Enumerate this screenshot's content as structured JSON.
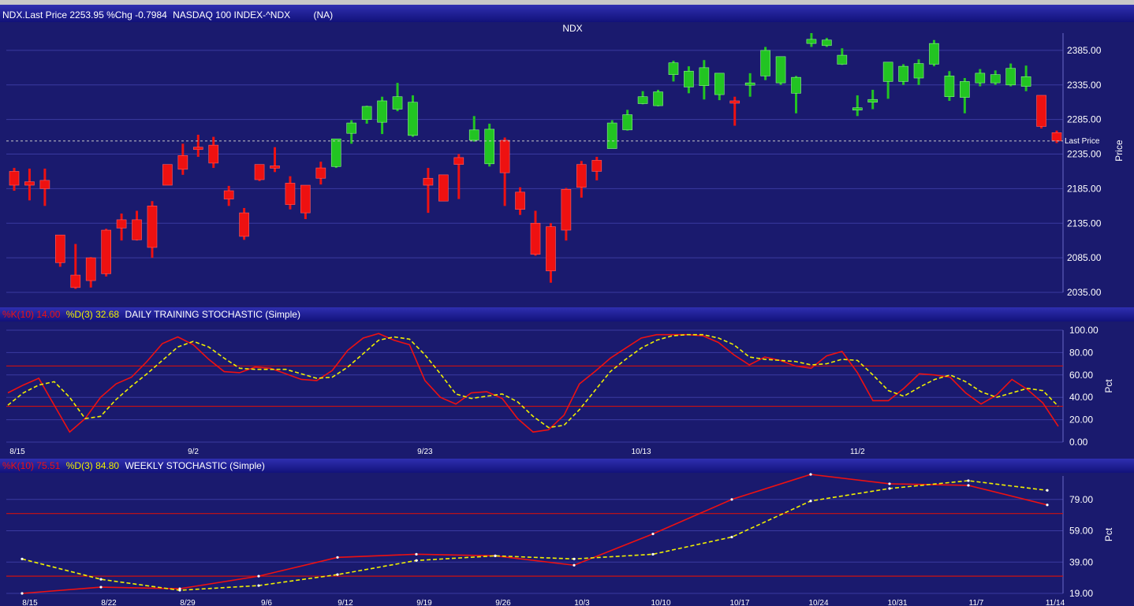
{
  "header_main": {
    "symbol_line": "NDX.Last Price 2253.95 %Chg -0.7984",
    "name": "NASDAQ 100 INDEX-^NDX",
    "status": "(NA)"
  },
  "header_daily": {
    "k_label": "%K(10) 14.00",
    "d_label": "%D(3) 32.68",
    "title": "DAILY TRAINING STOCHASTIC (Simple)"
  },
  "header_weekly": {
    "k_label": "%K(10) 75.51",
    "d_label": "%D(3) 84.80",
    "title": "WEEKLY STOCHASTIC (Simple)"
  },
  "colors": {
    "up": "#22c422",
    "down": "#ee1111",
    "k_line": "#ee1111",
    "d_line": "#f0f000",
    "threshold": "#cc1111",
    "last_price": "#c8c8c8",
    "title_green": "#22cc22"
  },
  "chart_data": [
    {
      "type": "candlestick",
      "title": "NDX",
      "ylabel": "Price",
      "ylim": [
        2035,
        2410
      ],
      "yticks": [
        2035,
        2085,
        2135,
        2185,
        2235,
        2285,
        2335,
        2385
      ],
      "ytick_labels": [
        "2035.00",
        "2085.00",
        "2135.00",
        "2185.00",
        "2235.00",
        "2285.00",
        "2335.00",
        "2385.00"
      ],
      "last_price": 2253.95,
      "last_price_label": "Last Price",
      "candles": [
        {
          "o": 2210,
          "h": 2215,
          "l": 2182,
          "c": 2190
        },
        {
          "o": 2195,
          "h": 2214,
          "l": 2168,
          "c": 2190
        },
        {
          "o": 2197,
          "h": 2214,
          "l": 2160,
          "c": 2185
        },
        {
          "o": 2118,
          "h": 2118,
          "l": 2072,
          "c": 2078
        },
        {
          "o": 2060,
          "h": 2105,
          "l": 2040,
          "c": 2042
        },
        {
          "o": 2085,
          "h": 2086,
          "l": 2042,
          "c": 2052
        },
        {
          "o": 2125,
          "h": 2127,
          "l": 2058,
          "c": 2062
        },
        {
          "o": 2140,
          "h": 2149,
          "l": 2110,
          "c": 2128
        },
        {
          "o": 2140,
          "h": 2153,
          "l": 2110,
          "c": 2111
        },
        {
          "o": 2160,
          "h": 2167,
          "l": 2085,
          "c": 2100
        },
        {
          "o": 2220,
          "h": 2220,
          "l": 2190,
          "c": 2190
        },
        {
          "o": 2233,
          "h": 2250,
          "l": 2205,
          "c": 2213
        },
        {
          "o": 2245,
          "h": 2263,
          "l": 2231,
          "c": 2242
        },
        {
          "o": 2248,
          "h": 2260,
          "l": 2215,
          "c": 2222
        },
        {
          "o": 2182,
          "h": 2189,
          "l": 2160,
          "c": 2170
        },
        {
          "o": 2150,
          "h": 2157,
          "l": 2111,
          "c": 2116
        },
        {
          "o": 2220,
          "h": 2220,
          "l": 2196,
          "c": 2198
        },
        {
          "o": 2218,
          "h": 2245,
          "l": 2209,
          "c": 2217
        },
        {
          "o": 2193,
          "h": 2203,
          "l": 2155,
          "c": 2162
        },
        {
          "o": 2190,
          "h": 2190,
          "l": 2141,
          "c": 2150
        },
        {
          "o": 2215,
          "h": 2224,
          "l": 2191,
          "c": 2200
        },
        {
          "o": 2217,
          "h": 2257,
          "l": 2215,
          "c": 2257
        },
        {
          "o": 2265,
          "h": 2284,
          "l": 2250,
          "c": 2280
        },
        {
          "o": 2285,
          "h": 2305,
          "l": 2279,
          "c": 2304
        },
        {
          "o": 2281,
          "h": 2318,
          "l": 2264,
          "c": 2312
        },
        {
          "o": 2300,
          "h": 2338,
          "l": 2297,
          "c": 2318
        },
        {
          "o": 2262,
          "h": 2320,
          "l": 2260,
          "c": 2310
        },
        {
          "o": 2200,
          "h": 2215,
          "l": 2150,
          "c": 2190
        },
        {
          "o": 2205,
          "h": 2205,
          "l": 2167,
          "c": 2167
        },
        {
          "o": 2230,
          "h": 2235,
          "l": 2170,
          "c": 2220
        },
        {
          "o": 2255,
          "h": 2290,
          "l": 2253,
          "c": 2270
        },
        {
          "o": 2221,
          "h": 2279,
          "l": 2217,
          "c": 2271
        },
        {
          "o": 2255,
          "h": 2259,
          "l": 2160,
          "c": 2208
        },
        {
          "o": 2180,
          "h": 2187,
          "l": 2147,
          "c": 2155
        },
        {
          "o": 2135,
          "h": 2153,
          "l": 2088,
          "c": 2090
        },
        {
          "o": 2130,
          "h": 2135,
          "l": 2049,
          "c": 2066
        },
        {
          "o": 2184,
          "h": 2186,
          "l": 2110,
          "c": 2125
        },
        {
          "o": 2220,
          "h": 2225,
          "l": 2172,
          "c": 2187
        },
        {
          "o": 2226,
          "h": 2231,
          "l": 2197,
          "c": 2210
        },
        {
          "o": 2243,
          "h": 2284,
          "l": 2243,
          "c": 2280
        },
        {
          "o": 2270,
          "h": 2299,
          "l": 2269,
          "c": 2292
        },
        {
          "o": 2308,
          "h": 2326,
          "l": 2307,
          "c": 2318
        },
        {
          "o": 2305,
          "h": 2328,
          "l": 2304,
          "c": 2325
        },
        {
          "o": 2350,
          "h": 2370,
          "l": 2340,
          "c": 2367
        },
        {
          "o": 2332,
          "h": 2362,
          "l": 2323,
          "c": 2355
        },
        {
          "o": 2334,
          "h": 2371,
          "l": 2314,
          "c": 2360
        },
        {
          "o": 2321,
          "h": 2352,
          "l": 2313,
          "c": 2352
        },
        {
          "o": 2312,
          "h": 2318,
          "l": 2276,
          "c": 2311
        },
        {
          "o": 2338,
          "h": 2352,
          "l": 2318,
          "c": 2338
        },
        {
          "o": 2348,
          "h": 2390,
          "l": 2342,
          "c": 2385
        },
        {
          "o": 2338,
          "h": 2376,
          "l": 2335,
          "c": 2376
        },
        {
          "o": 2323,
          "h": 2348,
          "l": 2294,
          "c": 2346
        },
        {
          "o": 2395,
          "h": 2410,
          "l": 2390,
          "c": 2401
        },
        {
          "o": 2392,
          "h": 2403,
          "l": 2390,
          "c": 2400
        },
        {
          "o": 2365,
          "h": 2388,
          "l": 2364,
          "c": 2378
        },
        {
          "o": 2300,
          "h": 2320,
          "l": 2290,
          "c": 2302
        },
        {
          "o": 2310,
          "h": 2328,
          "l": 2300,
          "c": 2314
        },
        {
          "o": 2340,
          "h": 2368,
          "l": 2315,
          "c": 2368
        },
        {
          "o": 2340,
          "h": 2365,
          "l": 2335,
          "c": 2362
        },
        {
          "o": 2345,
          "h": 2372,
          "l": 2335,
          "c": 2366
        },
        {
          "o": 2365,
          "h": 2400,
          "l": 2362,
          "c": 2395
        },
        {
          "o": 2318,
          "h": 2355,
          "l": 2312,
          "c": 2348
        },
        {
          "o": 2317,
          "h": 2345,
          "l": 2294,
          "c": 2340
        },
        {
          "o": 2338,
          "h": 2358,
          "l": 2333,
          "c": 2352
        },
        {
          "o": 2338,
          "h": 2356,
          "l": 2335,
          "c": 2350
        },
        {
          "o": 2335,
          "h": 2366,
          "l": 2333,
          "c": 2359
        },
        {
          "o": 2333,
          "h": 2363,
          "l": 2326,
          "c": 2347
        },
        {
          "o": 2320,
          "h": 2320,
          "l": 2272,
          "c": 2275
        },
        {
          "o": 2266,
          "h": 2269,
          "l": 2251,
          "c": 2254
        }
      ]
    },
    {
      "type": "line",
      "ylabel": "Pct",
      "ylim": [
        0,
        100
      ],
      "yticks": [
        0,
        20,
        40,
        60,
        80,
        100
      ],
      "ytick_labels": [
        "0.00",
        "20.00",
        "40.00",
        "60.00",
        "80.00",
        "100.00"
      ],
      "thresholds": [
        32,
        68
      ],
      "x_labels": [
        {
          "text": "8/15",
          "index": 0
        },
        {
          "text": "9/2",
          "index": 12
        },
        {
          "text": "9/23",
          "index": 27
        },
        {
          "text": "10/13",
          "index": 41
        },
        {
          "text": "11/2",
          "index": 55
        }
      ],
      "series": [
        {
          "key": "k",
          "values": [
            44,
            51,
            57,
            33,
            9,
            21,
            40,
            52,
            58,
            72,
            88,
            94,
            87,
            74,
            63,
            62,
            67,
            66,
            61,
            56,
            55,
            64,
            82,
            93,
            97,
            91,
            87,
            55,
            40,
            34,
            44,
            45,
            39,
            21,
            9,
            11,
            24,
            52,
            63,
            75,
            84,
            93,
            96,
            96,
            96,
            95,
            89,
            78,
            69,
            76,
            73,
            68,
            66,
            77,
            81,
            62,
            37,
            37,
            48,
            61,
            60,
            58,
            44,
            34,
            42,
            56,
            47,
            35,
            14
          ]
        },
        {
          "key": "d",
          "values": [
            33,
            44,
            51,
            54,
            40,
            21,
            23,
            38,
            50,
            61,
            73,
            85,
            90,
            85,
            75,
            66,
            65,
            65,
            65,
            61,
            57,
            58,
            67,
            79,
            91,
            94,
            92,
            78,
            61,
            43,
            39,
            41,
            43,
            36,
            23,
            13,
            15,
            29,
            46,
            63,
            74,
            84,
            91,
            95,
            96,
            96,
            93,
            87,
            76,
            74,
            73,
            72,
            69,
            70,
            74,
            73,
            60,
            46,
            41,
            49,
            56,
            60,
            54,
            45,
            40,
            44,
            48,
            46,
            32
          ]
        }
      ]
    },
    {
      "type": "line",
      "ylabel": "Pct",
      "ylim": [
        19,
        94
      ],
      "yticks": [
        19,
        39,
        59,
        79
      ],
      "ytick_labels": [
        "19.00",
        "39.00",
        "59.00",
        "79.00"
      ],
      "thresholds": [
        30,
        70
      ],
      "categories": [
        "8/15",
        "8/22",
        "8/29",
        "9/6",
        "9/12",
        "9/19",
        "9/26",
        "10/3",
        "10/10",
        "10/17",
        "10/24",
        "10/31",
        "11/7",
        "11/14"
      ],
      "series": [
        {
          "key": "k",
          "values": [
            19,
            23,
            22,
            30,
            42,
            44,
            43,
            37,
            57,
            79,
            95,
            89,
            88,
            75.51
          ]
        },
        {
          "key": "d",
          "values": [
            41,
            28,
            21,
            24,
            31,
            40,
            43,
            41,
            44,
            55,
            78,
            86,
            91,
            84.8
          ]
        }
      ]
    }
  ]
}
